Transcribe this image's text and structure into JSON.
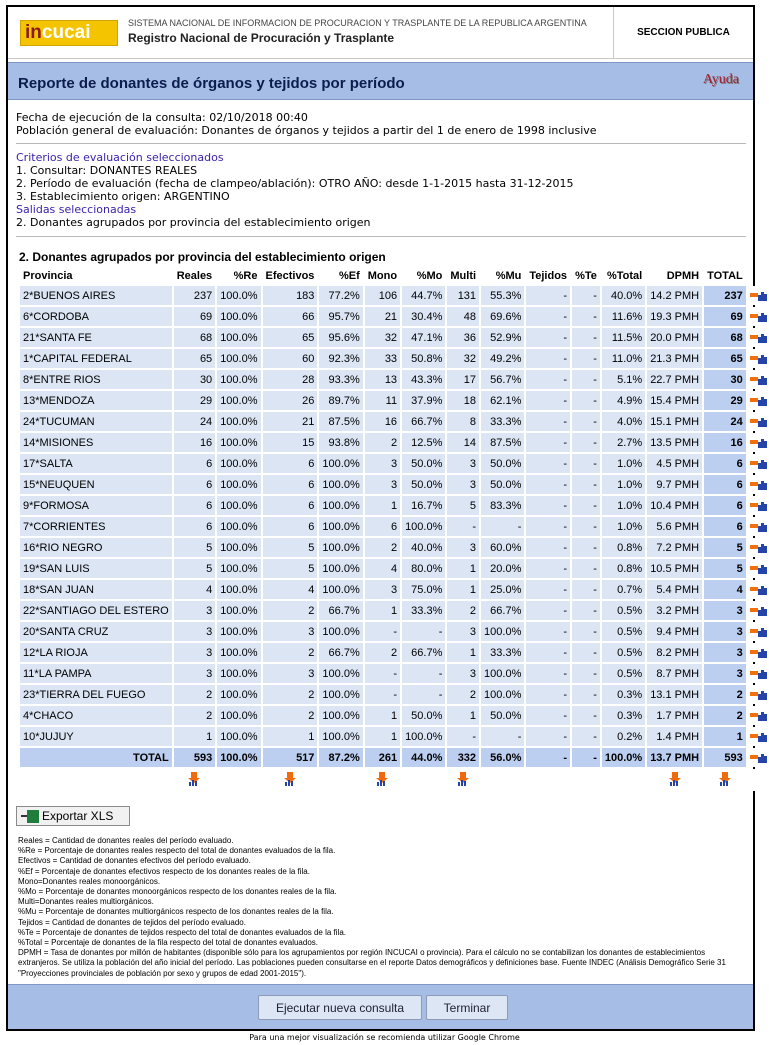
{
  "header": {
    "logo_prefix": "in",
    "logo_suffix": "cucai",
    "system": "SISTEMA NACIONAL DE INFORMACION DE PROCURACION Y TRASPLANTE DE LA REPUBLICA ARGENTINA",
    "registry": "Registro Nacional de Procuración y Trasplante",
    "section": "SECCION PUBLICA"
  },
  "page": {
    "title": "Reporte de donantes de órganos y tejidos por período",
    "help": "Ayuda"
  },
  "info": {
    "exec_date": "Fecha de ejecución de la consulta: 02/10/2018 00:40",
    "population": "Población general de evaluación: Donantes de órganos y tejidos a partir del 1 de enero de 1998 inclusive"
  },
  "criteria": {
    "heading": "Criterios de evaluación seleccionados",
    "items": [
      "1. Consultar: DONANTES REALES",
      "2. Período de evaluación (fecha de clampeo/ablación): OTRO AÑO: desde 1-1-2015 hasta 31-12-2015",
      "3. Establecimiento origen: ARGENTINO"
    ],
    "outputs_heading": "Salidas seleccionadas",
    "outputs": [
      "2. Donantes agrupados por provincia del establecimiento origen"
    ]
  },
  "table": {
    "title": "2. Donantes agrupados por provincia del establecimiento origen",
    "headers": [
      "Provincia",
      "Reales",
      "%Re",
      "Efectivos",
      "%Ef",
      "Mono",
      "%Mo",
      "Multi",
      "%Mu",
      "Tejidos",
      "%Te",
      "%Total",
      "DPMH",
      "TOTAL"
    ],
    "rows": [
      [
        "2*BUENOS AIRES",
        "237",
        "100.0%",
        "183",
        "77.2%",
        "106",
        "44.7%",
        "131",
        "55.3%",
        "-",
        "-",
        "40.0%",
        "14.2 PMH",
        "237"
      ],
      [
        "6*CORDOBA",
        "69",
        "100.0%",
        "66",
        "95.7%",
        "21",
        "30.4%",
        "48",
        "69.6%",
        "-",
        "-",
        "11.6%",
        "19.3 PMH",
        "69"
      ],
      [
        "21*SANTA FE",
        "68",
        "100.0%",
        "65",
        "95.6%",
        "32",
        "47.1%",
        "36",
        "52.9%",
        "-",
        "-",
        "11.5%",
        "20.0 PMH",
        "68"
      ],
      [
        "1*CAPITAL FEDERAL",
        "65",
        "100.0%",
        "60",
        "92.3%",
        "33",
        "50.8%",
        "32",
        "49.2%",
        "-",
        "-",
        "11.0%",
        "21.3 PMH",
        "65"
      ],
      [
        "8*ENTRE RIOS",
        "30",
        "100.0%",
        "28",
        "93.3%",
        "13",
        "43.3%",
        "17",
        "56.7%",
        "-",
        "-",
        "5.1%",
        "22.7 PMH",
        "30"
      ],
      [
        "13*MENDOZA",
        "29",
        "100.0%",
        "26",
        "89.7%",
        "11",
        "37.9%",
        "18",
        "62.1%",
        "-",
        "-",
        "4.9%",
        "15.4 PMH",
        "29"
      ],
      [
        "24*TUCUMAN",
        "24",
        "100.0%",
        "21",
        "87.5%",
        "16",
        "66.7%",
        "8",
        "33.3%",
        "-",
        "-",
        "4.0%",
        "15.1 PMH",
        "24"
      ],
      [
        "14*MISIONES",
        "16",
        "100.0%",
        "15",
        "93.8%",
        "2",
        "12.5%",
        "14",
        "87.5%",
        "-",
        "-",
        "2.7%",
        "13.5 PMH",
        "16"
      ],
      [
        "17*SALTA",
        "6",
        "100.0%",
        "6",
        "100.0%",
        "3",
        "50.0%",
        "3",
        "50.0%",
        "-",
        "-",
        "1.0%",
        "4.5 PMH",
        "6"
      ],
      [
        "15*NEUQUEN",
        "6",
        "100.0%",
        "6",
        "100.0%",
        "3",
        "50.0%",
        "3",
        "50.0%",
        "-",
        "-",
        "1.0%",
        "9.7 PMH",
        "6"
      ],
      [
        "9*FORMOSA",
        "6",
        "100.0%",
        "6",
        "100.0%",
        "1",
        "16.7%",
        "5",
        "83.3%",
        "-",
        "-",
        "1.0%",
        "10.4 PMH",
        "6"
      ],
      [
        "7*CORRIENTES",
        "6",
        "100.0%",
        "6",
        "100.0%",
        "6",
        "100.0%",
        "-",
        "-",
        "-",
        "-",
        "1.0%",
        "5.6 PMH",
        "6"
      ],
      [
        "16*RIO NEGRO",
        "5",
        "100.0%",
        "5",
        "100.0%",
        "2",
        "40.0%",
        "3",
        "60.0%",
        "-",
        "-",
        "0.8%",
        "7.2 PMH",
        "5"
      ],
      [
        "19*SAN LUIS",
        "5",
        "100.0%",
        "5",
        "100.0%",
        "4",
        "80.0%",
        "1",
        "20.0%",
        "-",
        "-",
        "0.8%",
        "10.5 PMH",
        "5"
      ],
      [
        "18*SAN JUAN",
        "4",
        "100.0%",
        "4",
        "100.0%",
        "3",
        "75.0%",
        "1",
        "25.0%",
        "-",
        "-",
        "0.7%",
        "5.4 PMH",
        "4"
      ],
      [
        "22*SANTIAGO DEL ESTERO",
        "3",
        "100.0%",
        "2",
        "66.7%",
        "1",
        "33.3%",
        "2",
        "66.7%",
        "-",
        "-",
        "0.5%",
        "3.2 PMH",
        "3"
      ],
      [
        "20*SANTA CRUZ",
        "3",
        "100.0%",
        "3",
        "100.0%",
        "-",
        "-",
        "3",
        "100.0%",
        "-",
        "-",
        "0.5%",
        "9.4 PMH",
        "3"
      ],
      [
        "12*LA RIOJA",
        "3",
        "100.0%",
        "2",
        "66.7%",
        "2",
        "66.7%",
        "1",
        "33.3%",
        "-",
        "-",
        "0.5%",
        "8.2 PMH",
        "3"
      ],
      [
        "11*LA PAMPA",
        "3",
        "100.0%",
        "3",
        "100.0%",
        "-",
        "-",
        "3",
        "100.0%",
        "-",
        "-",
        "0.5%",
        "8.7 PMH",
        "3"
      ],
      [
        "23*TIERRA DEL FUEGO",
        "2",
        "100.0%",
        "2",
        "100.0%",
        "-",
        "-",
        "2",
        "100.0%",
        "-",
        "-",
        "0.3%",
        "13.1 PMH",
        "2"
      ],
      [
        "4*CHACO",
        "2",
        "100.0%",
        "2",
        "100.0%",
        "1",
        "50.0%",
        "1",
        "50.0%",
        "-",
        "-",
        "0.3%",
        "1.7 PMH",
        "2"
      ],
      [
        "10*JUJUY",
        "1",
        "100.0%",
        "1",
        "100.0%",
        "1",
        "100.0%",
        "-",
        "-",
        "-",
        "-",
        "0.2%",
        "1.4 PMH",
        "1"
      ]
    ],
    "total": [
      "TOTAL",
      "593",
      "100.0%",
      "517",
      "87.2%",
      "261",
      "44.0%",
      "332",
      "56.0%",
      "-",
      "-",
      "100.0%",
      "13.7 PMH",
      "593"
    ]
  },
  "export_label": "Exportar XLS",
  "legend": [
    "Reales = Cantidad de donantes reales del período evaluado.",
    "%Re = Porcentaje de donantes reales respecto del total de donantes evaluados de la fila.",
    "Efectivos = Cantidad de donantes efectivos del período evaluado.",
    "%Ef = Porcentaje de donantes efectivos respecto de los donantes reales de la fila.",
    "Mono=Donantes reales monoorgánicos.",
    "%Mo = Porcentaje de donantes monoorgánicos respecto de los donantes reales de la fila.",
    "Multi=Donantes reales multiorgánicos.",
    "%Mu = Porcentaje de donantes multiorgánicos respecto de los donantes reales de la fila.",
    "Tejidos = Cantidad de donantes de tejidos del período evaluado.",
    "%Te = Porcentaje de donantes de tejidos respecto del total de donantes evaluados de la fila.",
    "%Total = Porcentaje de donantes de la fila respecto del total de donantes evaluados.",
    "DPMH = Tasa de donantes por millón de habitantes (disponible sólo para los agrupamientos por región INCUCAI o provincia). Para el cálculo no se contabilizan los donantes de establecimientos extranjeros. Se utiliza la población del año inicial del período. Las poblaciones pueden consultarse en el reporte Datos demográficos y definiciones base. Fuente INDEC (Análisis Demográfico Serie 31 \"Proyecciones provinciales de población por sexo y grupos de edad 2001-2015\")."
  ],
  "buttons": {
    "new_query": "Ejecutar nueva consulta",
    "finish": "Terminar"
  },
  "footer_note": "Para una mejor visualización se recomienda utilizar Google Chrome"
}
